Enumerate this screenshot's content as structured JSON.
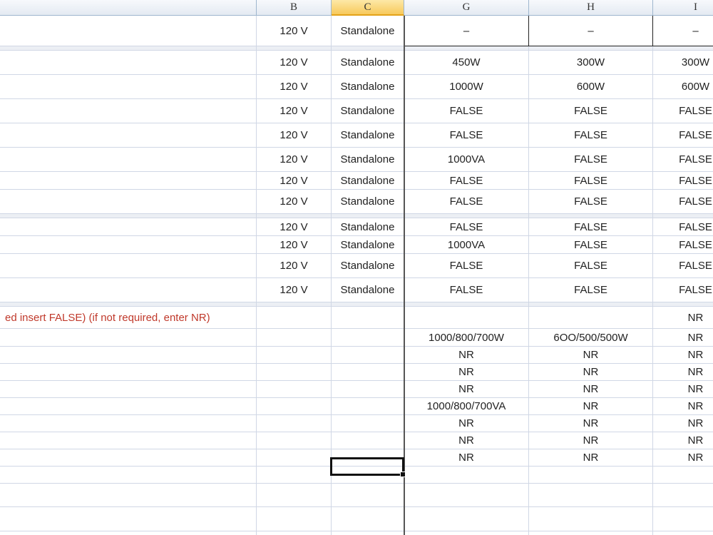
{
  "columns": [
    "",
    "B",
    "C",
    "G",
    "H",
    "I"
  ],
  "selected_column": "C",
  "rows": [
    {
      "a": "",
      "b": "120 V",
      "c": "Standalone",
      "g": "–",
      "h": "–",
      "i": "–"
    },
    {
      "separator": true
    },
    {
      "a": "",
      "b": "120 V",
      "c": "Standalone",
      "g": "450W",
      "h": "300W",
      "i": "300W"
    },
    {
      "a": "",
      "b": "120 V",
      "c": "Standalone",
      "g": "1000W",
      "h": "600W",
      "i": "600W"
    },
    {
      "a": "",
      "b": "120 V",
      "c": "Standalone",
      "g": "FALSE",
      "h": "FALSE",
      "i": "FALSE"
    },
    {
      "a": "",
      "b": "120 V",
      "c": "Standalone",
      "g": "FALSE",
      "h": "FALSE",
      "i": "FALSE"
    },
    {
      "a": "",
      "b": "120 V",
      "c": "Standalone",
      "g": "1000VA",
      "h": "FALSE",
      "i": "FALSE"
    },
    {
      "a": "",
      "b": "120 V",
      "c": "Standalone",
      "g": "FALSE",
      "h": "FALSE",
      "i": "FALSE"
    },
    {
      "a": "",
      "b": "120 V",
      "c": "Standalone",
      "g": "FALSE",
      "h": "FALSE",
      "i": "FALSE"
    },
    {
      "separator": true
    },
    {
      "a": "",
      "b": "120 V",
      "c": "Standalone",
      "g": "FALSE",
      "h": "FALSE",
      "i": "FALSE"
    },
    {
      "a": "",
      "b": "120 V",
      "c": "Standalone",
      "g": "1000VA",
      "h": "FALSE",
      "i": "FALSE"
    },
    {
      "a": "",
      "b": "120 V",
      "c": "Standalone",
      "g": "FALSE",
      "h": "FALSE",
      "i": "FALSE"
    },
    {
      "a": "",
      "b": "120 V",
      "c": "Standalone",
      "g": "FALSE",
      "h": "FALSE",
      "i": "FALSE"
    },
    {
      "separator": true
    },
    {
      "a": "ed insert FALSE) (if not required, enter NR)",
      "red": true,
      "b": "",
      "c": "",
      "g": "",
      "h": "",
      "i": "NR"
    },
    {
      "a": "",
      "b": "",
      "c": "",
      "g": "1000/800/700W",
      "h": "6OO/500/500W",
      "i": "NR"
    },
    {
      "a": "",
      "b": "",
      "c": "",
      "g": "NR",
      "h": "NR",
      "i": "NR"
    },
    {
      "a": "",
      "b": "",
      "c": "",
      "g": "NR",
      "h": "NR",
      "i": "NR"
    },
    {
      "a": "",
      "b": "",
      "c": "",
      "g": "NR",
      "h": "NR",
      "i": "NR"
    },
    {
      "a": "",
      "b": "",
      "c": "",
      "g": "1000/800/700VA",
      "h": "NR",
      "i": "NR"
    },
    {
      "a": "",
      "b": "",
      "c": "",
      "g": "NR",
      "h": "NR",
      "i": "NR"
    },
    {
      "a": "",
      "b": "",
      "c": "",
      "g": "NR",
      "h": "NR",
      "i": "NR"
    },
    {
      "a": "",
      "b": "",
      "c": "",
      "g": "NR",
      "h": "NR",
      "i": "NR"
    },
    {
      "a": "",
      "b": "",
      "c": "",
      "g": "",
      "h": "",
      "i": ""
    },
    {
      "a": "",
      "b": "",
      "c": "",
      "g": "",
      "h": "",
      "i": ""
    },
    {
      "a": "",
      "b": "",
      "c": "",
      "g": "",
      "h": "",
      "i": ""
    },
    {
      "a": "",
      "b": "",
      "c": "",
      "g": "",
      "h": "",
      "i": ""
    }
  ]
}
